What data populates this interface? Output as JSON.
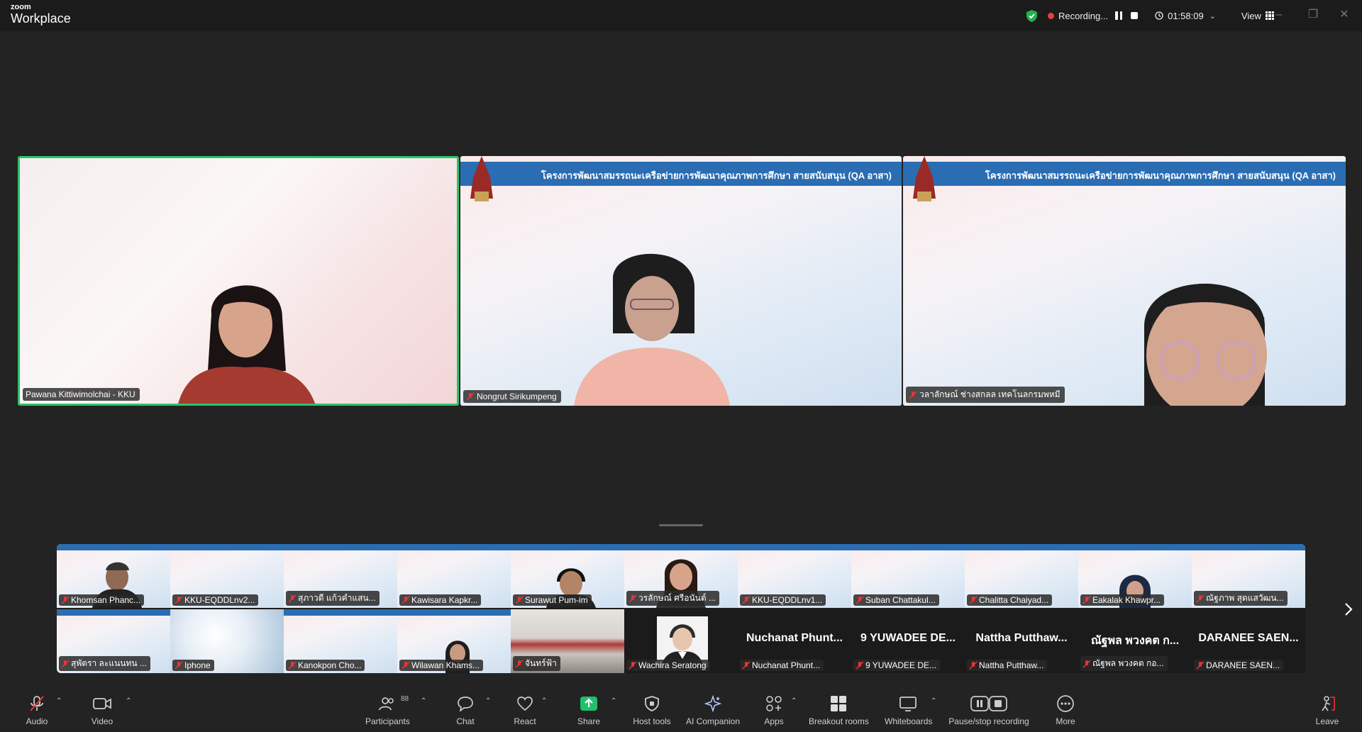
{
  "titlebar": {
    "brand_top": "zoom",
    "brand_main": "Workplace",
    "recording_label": "Recording...",
    "timer": "01:58:09",
    "view_label": "View"
  },
  "speakers": [
    {
      "name": "Pawana Kittiwimolchai - KKU",
      "active": true
    },
    {
      "name": "Nongrut Sirikumpeng",
      "banner": "โครงการพัฒนาสมรรถนะเครือข่ายการพัฒนาคุณภาพการศึกษา สายสนับสนุน (QA อาสา)"
    },
    {
      "name": "วลาลักษณ์ ช่างสกลล เทคโนลกรมพหมี",
      "banner": "โครงการพัฒนาสมรรถนะเครือข่ายการพัฒนาคุณภาพการศึกษา สายสนับสนุน (QA อาสา)"
    }
  ],
  "gallery": {
    "row1": [
      "Khomsan Phanc...",
      "KKU-EQDDLnv2...",
      "สุภาวดี แก้วคำแสน...",
      "Kawisara Kapkr...",
      "Surawut Pum-im",
      "วรลักษณ์ ศรีอนันต์ ...",
      "KKU-EQDDLnv1...",
      "Suban Chattakul...",
      "Chalitta Chaiyad...",
      "Eakalak Khawpr...",
      "ณัฐภาพ สุดแสวัฒน..."
    ],
    "row2": [
      "สุพัตรา ละแนนทน ...",
      "Iphone",
      "Kanokpon Cho...",
      "Wilawan Khams...",
      "จันทร์ฟ้า",
      "Wachira Seratong",
      "Nuchanat Phunt...",
      "9 YUWADEE DE...",
      "Nattha Putthaw...",
      "ณัฐพล พวงคต ก...",
      "DARANEE SAEN..."
    ],
    "row2_big": [
      "Nuchanat Phunt...",
      "9 YUWADEE DE...",
      "Nattha Putthaw...",
      "ณัฐพล พวงคต ก...",
      "DARANEE SAEN..."
    ],
    "row2_small": [
      "Nuchanat Phunt...",
      "9 YUWADEE DE...",
      "Nattha Putthaw...",
      "ณัฐพล พวงคต กอ...",
      "DARANEE SAEN..."
    ]
  },
  "toolbar": {
    "audio": "Audio",
    "video": "Video",
    "participants": "Participants",
    "participants_count": "88",
    "chat": "Chat",
    "react": "React",
    "share": "Share",
    "host_tools": "Host tools",
    "ai_companion": "AI Companion",
    "apps": "Apps",
    "breakout_rooms": "Breakout rooms",
    "whiteboards": "Whiteboards",
    "pause_stop_recording": "Pause/stop recording",
    "more": "More",
    "leave": "Leave"
  },
  "colors": {
    "background": "#232323",
    "active_speaker_border": "#29c46a",
    "banner_blue": "#2a6db3",
    "share_green": "#1fc06b",
    "record_red": "#e8403a",
    "shield_green": "#23b14d"
  }
}
